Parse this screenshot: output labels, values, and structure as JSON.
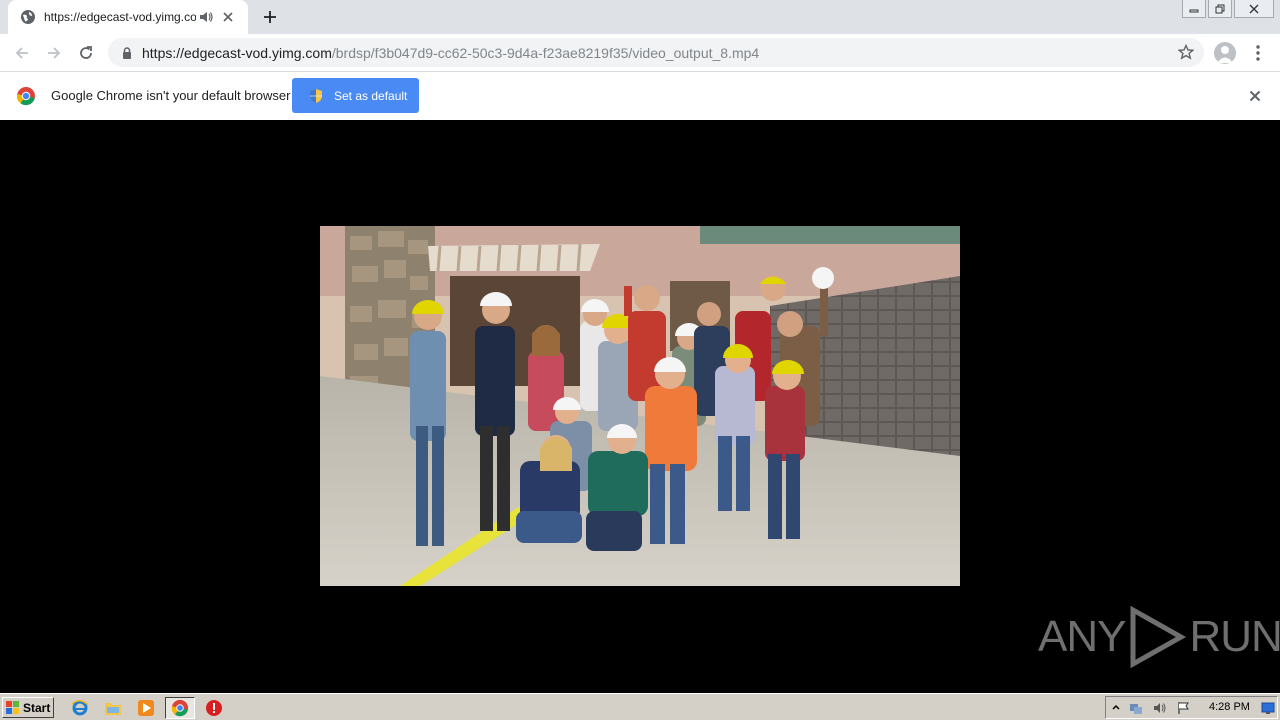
{
  "tab": {
    "title": "https://edgecast-vod.yimg.com"
  },
  "address": {
    "host": "https://edgecast-vod.yimg.com",
    "path": "/brdsp/f3b047d9-cc62-50c3-9d4a-f23ae8219f35/video_output_8.mp4"
  },
  "infobar": {
    "message": "Google Chrome isn't your default browser",
    "button_label": "Set as default"
  },
  "watermark": {
    "left": "ANY",
    "right": "RUN"
  },
  "taskbar": {
    "start_label": "Start",
    "clock": "4:28 PM"
  },
  "colors": {
    "tab_strip": "#dee1e6",
    "accent_button": "#4a8af4",
    "taskbar": "#d4d0c8"
  }
}
